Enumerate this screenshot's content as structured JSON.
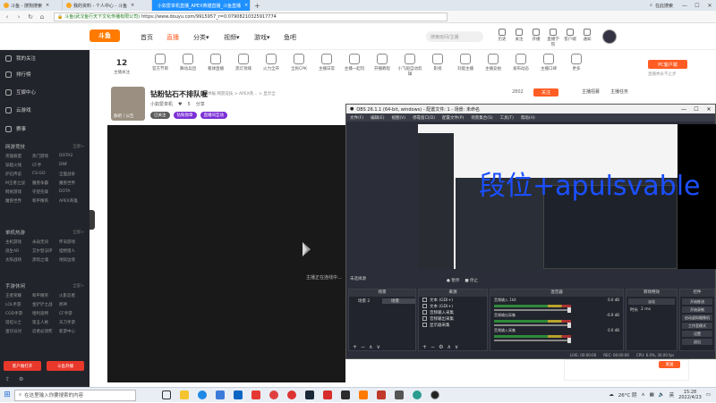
{
  "browser": {
    "tabs": [
      {
        "label": "斗鱼 - 搜狗搜索",
        "active": false
      },
      {
        "label": "我的资料 - 个人中心 - 斗鱼",
        "active": false
      },
      {
        "label": "小如爱单机直播_APEX英雄直播_斗鱼直播",
        "active": true
      }
    ],
    "search_right": "在此搜索",
    "url_secure": "斗鱼(武汉鱼行天下文化传播有限公司)",
    "url": "https://www.douyu.com/9915957_r=0.07908210325917774"
  },
  "header": {
    "logo": "斗鱼",
    "nav": [
      "首页",
      "直播",
      "分类▾",
      "视频▾",
      "游戏▾",
      "鱼吧"
    ],
    "search_placeholder": "搜索房间/主播",
    "icons": [
      "历史",
      "关注",
      "开播",
      "直播学院",
      "客户端",
      "通知"
    ]
  },
  "sidebar": {
    "items": [
      "我的关注",
      "排行榜",
      "互娱中心",
      "云游戏",
      "赛事"
    ],
    "groups": [
      {
        "title": "网游竞技",
        "more": "全部>",
        "items": [
          "英雄联盟",
          "热门游戏",
          "DOTA2",
          "穿越火线",
          "CF手",
          "DNF",
          "炉石传说",
          "CS:GO",
          "全面战争",
          "M王者之战",
          "魔兽争霸",
          "魔兽世界",
          "网易游戏",
          "守望先锋",
          "DOTA",
          "魔兽世界",
          "和平精英",
          "APEX英雄"
        ]
      },
      {
        "title": "单机热游",
        "more": "全部>",
        "items": [
          "主机游戏",
          "永劫无间",
          "怀旧游戏",
          "逃生AR",
          "艾尔登法环",
          "怪物猎人",
          "太阳战场",
          "黑暗之魂",
          "地狱边境"
        ]
      },
      {
        "title": "手游休闲",
        "more": "全部>",
        "items": [
          "王者荣耀",
          "和平精英",
          "火影忍者",
          "LOL手游",
          "金铲铲之战",
          "原神",
          "COD手游",
          "哈利波特",
          "CF手游",
          "塔坦斗士",
          "第五人格",
          "天刀手游",
          "蛋仔派对",
          "忍者必须死",
          "新游中心"
        ]
      }
    ],
    "buttons": [
      "客户端打开",
      "斗鱼开播"
    ],
    "footer": [
      "分享",
      "设置"
    ]
  },
  "category_bar": {
    "follow_count": "12",
    "follow_label": "主播关注",
    "items": [
      "直播汇总",
      "官方节目",
      "舞动兵团",
      "看球直播",
      "黑灯领域",
      "火力全开",
      "全民CPK",
      "主播日常",
      "主播一起玩",
      "开播教程",
      "小飞船自动剪辑",
      "影视",
      "刘能主播",
      "主播竞拍",
      "发布动态",
      "主播口碑",
      "更多"
    ],
    "pc_client": "PC客户端",
    "pc_sub": "直播秀永不止步"
  },
  "room": {
    "thumb_label": "魚吧丨公告",
    "title": "钻粉钻石不排队喔",
    "meta": "举报  网游竞技 > APEX英... > 显示全",
    "host": "小如爱单机",
    "likes": "5",
    "share": "分享",
    "tags": [
      "已关注",
      "钻粉勋章",
      "直播间互动"
    ],
    "count": "2802",
    "follow_btn": "关注",
    "hot": [
      "主播招募",
      "主播任务"
    ]
  },
  "player": {
    "loading": "主播正在连线中..."
  },
  "obs": {
    "title": "OBS 26.1.1 (64-bit, windows) - 配置文件: 1 - 场景: 未命名",
    "menu": [
      "文件(F)",
      "编辑(E)",
      "视图(V)",
      "停靠窗口(D)",
      "配置文件(P)",
      "场景集合(S)",
      "工具(T)",
      "帮助(H)"
    ],
    "overlay_text": "段位+apulsvable",
    "no_source": "未选择源",
    "pause": "● 暂停",
    "stop": "■ 停止",
    "docks": {
      "scenes": {
        "title": "场景",
        "rows": [
          [
            "场景 2",
            "场景"
          ]
        ]
      },
      "sources": {
        "title": "来源",
        "rows": [
          "文本 (GDI+)",
          "文本 (GDI+)",
          "音频输入采集",
          "音频输出采集",
          "显示器采集"
        ]
      },
      "mixer": {
        "title": "混音器",
        "rows": [
          {
            "label": "音频输入 1kit",
            "val": "0.0 dB"
          },
          {
            "label": "音频输出采集",
            "val": "-6.9 dB"
          },
          {
            "label": "音频输入采集",
            "val": "0.0 dB"
          }
        ]
      },
      "transitions": {
        "title": "转场特效",
        "fade": "淡化",
        "duration_label": "时长",
        "duration": "2 ms"
      },
      "controls": {
        "title": "控件",
        "buttons": [
          "开始推流",
          "开始录制",
          "启动虚拟摄像机",
          "工作室模式",
          "设置",
          "退出"
        ]
      }
    },
    "status": [
      "LIVE: 00:00:00",
      "REC: 00:00:00",
      "CPU: 6.0%, 30.00 fps"
    ]
  },
  "chat": {
    "send": "发送"
  },
  "taskbar": {
    "search_placeholder": "在这里输入你要搜索的内容",
    "weather": "26°C 阴",
    "lang": "英",
    "time": "15:28",
    "date": "2022/4/23"
  },
  "colors": {
    "accent": "#ff5d23",
    "obs_bg": "#2b2e38",
    "overlay_text": "#1b4fff",
    "sidebar_bg": "#22242b"
  }
}
